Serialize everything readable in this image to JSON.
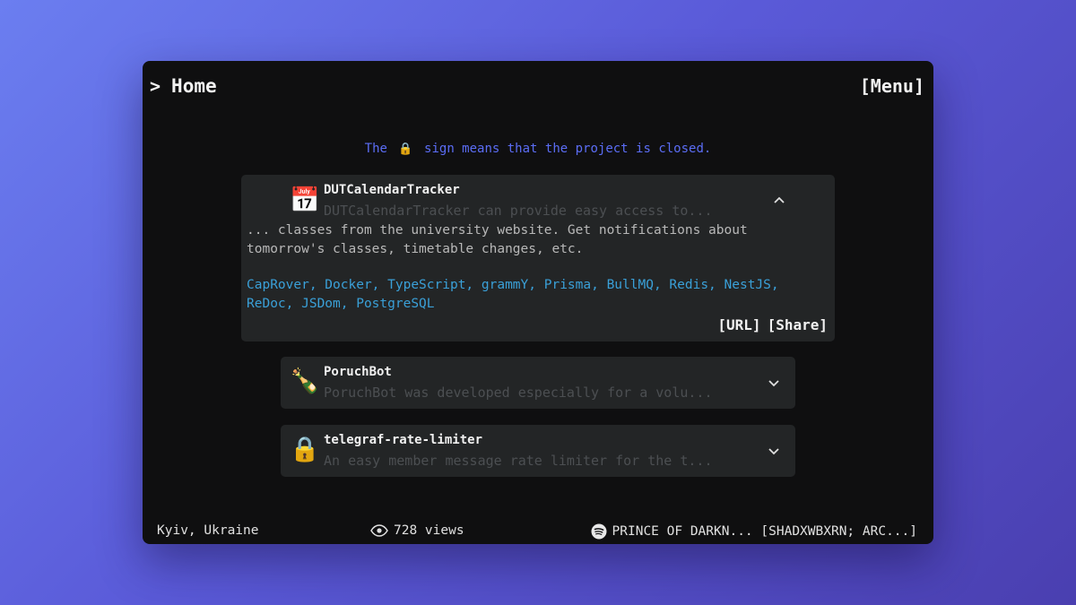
{
  "header": {
    "breadcrumb_icon": ">",
    "title": "Home",
    "menu_label": "[Menu]"
  },
  "notice": {
    "before": "The",
    "icon": "lock-icon",
    "after": "sign means that the project is closed."
  },
  "projects": [
    {
      "name": "DUTCalendarTracker",
      "emoji": "📅",
      "description": "DUTCalendarTracker can provide easy access to...",
      "full_description": "... classes from the university website. Get notifications about tomorrow's classes, timetable changes, etc.",
      "tech": "CapRover, Docker, TypeScript, grammY, Prisma, BullMQ, Redis, NestJS, ReDoc, JSDom, PostgreSQL",
      "url_label": "[URL]",
      "share_label": "[Share]",
      "expanded": true,
      "toggle": "^"
    },
    {
      "name": "PoruchBot",
      "emoji": "🍾",
      "description": "PoruchBot was developed especially for a volu...",
      "expanded": false,
      "toggle": "v"
    },
    {
      "name": "telegraf-rate-limiter",
      "emoji": "🔒",
      "description": "An easy member message rate limiter for the t...",
      "expanded": false,
      "toggle": "v"
    }
  ],
  "footer": {
    "location": "Kyiv, Ukraine",
    "views": "728 views",
    "now_playing": "PRINCE OF DARKN... [SHADXWBXRN; ARC...]"
  },
  "colors": {
    "notice": "#5b6df5",
    "tags": "#3aa0d8",
    "card_bg": "#232526",
    "window_bg": "#0f0f10"
  }
}
